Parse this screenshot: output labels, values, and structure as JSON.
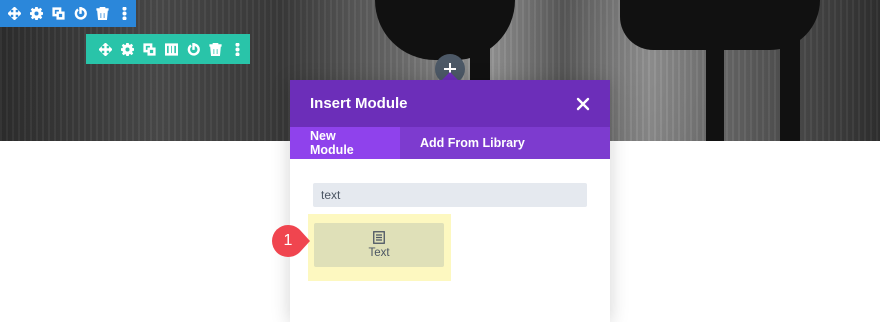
{
  "section_toolbar": {
    "icons": [
      "move-icon",
      "gear-icon",
      "duplicate-icon",
      "power-icon",
      "trash-icon",
      "more-icon"
    ],
    "color": "#2b87da"
  },
  "row_toolbar": {
    "icons": [
      "move-icon",
      "gear-icon",
      "duplicate-icon",
      "columns-icon",
      "power-icon",
      "trash-icon",
      "more-icon"
    ],
    "color": "#29c4a9"
  },
  "modal": {
    "title": "Insert Module",
    "tabs": [
      {
        "label": "New Module",
        "active": true
      },
      {
        "label": "Add From Library",
        "active": false
      }
    ],
    "search": {
      "value": "text"
    },
    "modules": [
      {
        "label": "Text",
        "icon": "text-module-icon"
      }
    ],
    "header_color": "#6c2eb9",
    "tabs_color": "#7d3bcf",
    "active_tab_color": "#8f42ec"
  },
  "annotation": {
    "number": "1",
    "color": "#f0454f"
  }
}
